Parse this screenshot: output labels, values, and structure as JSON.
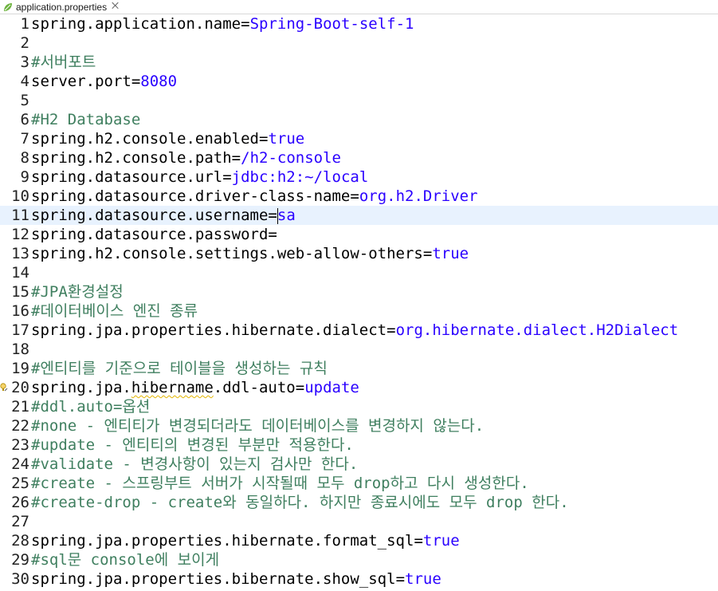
{
  "tab": {
    "title": "application.properties",
    "close_glyph": "⨉"
  },
  "lines": [
    {
      "num": "1",
      "key": "spring.application.name",
      "eq": "=",
      "val": "Spring-Boot-self-1"
    },
    {
      "num": "2"
    },
    {
      "num": "3",
      "comment": "#서버포트"
    },
    {
      "num": "4",
      "key": "server.port",
      "eq": "=",
      "val": "8080"
    },
    {
      "num": "5"
    },
    {
      "num": "6",
      "comment": "#H2 Database"
    },
    {
      "num": "7",
      "key": "spring.h2.console.enabled",
      "eq": "=",
      "val": "true"
    },
    {
      "num": "8",
      "key": "spring.h2.console.path",
      "eq": "=",
      "val": "/h2-console"
    },
    {
      "num": "9",
      "key": "spring.datasource.url",
      "eq": "=",
      "val": "jdbc:h2:~/local"
    },
    {
      "num": "10",
      "key": "spring.datasource.driver-class-name",
      "eq": "=",
      "val": "org.h2.Driver"
    },
    {
      "num": "11",
      "key": "spring.datasource.username",
      "eq": "=",
      "val": "sa"
    },
    {
      "num": "12",
      "key": "spring.datasource.password",
      "eq": "=",
      "val": ""
    },
    {
      "num": "13",
      "key": "spring.h2.console.settings.web-allow-others",
      "eq": "=",
      "val": "true"
    },
    {
      "num": "14"
    },
    {
      "num": "15",
      "comment": "#JPA환경설정"
    },
    {
      "num": "16",
      "comment": "#데이터베이스 엔진 종류"
    },
    {
      "num": "17",
      "key": "spring.jpa.properties.hibernate.dialect",
      "eq": "=",
      "val": "org.hibernate.dialect.H2Dialect"
    },
    {
      "num": "18"
    },
    {
      "num": "19",
      "comment": "#엔티티를 기준으로 테이블을 생성하는 규칙"
    },
    {
      "num": "20",
      "key_pre": "spring.jpa.",
      "key_warn": "hibername",
      "key_post": ".ddl-auto",
      "eq": "=",
      "val": "update"
    },
    {
      "num": "21",
      "comment": "#ddl.auto=옵션"
    },
    {
      "num": "22",
      "comment": "#none - 엔티티가 변경되더라도 데이터베이스를 변경하지 않는다."
    },
    {
      "num": "23",
      "comment": "#update - 엔티티의 변경된 부분만 적용한다."
    },
    {
      "num": "24",
      "comment": "#validate - 변경사항이 있는지 검사만 한다."
    },
    {
      "num": "25",
      "comment": "#create - 스프링부트 서버가 시작될때 모두 drop하고 다시 생성한다."
    },
    {
      "num": "26",
      "comment": "#create-drop - create와 동일하다. 하지만 종료시에도 모두 drop 한다."
    },
    {
      "num": "27"
    },
    {
      "num": "28",
      "key": "spring.jpa.properties.hibernate.format_sql",
      "eq": "=",
      "val": "true"
    },
    {
      "num": "29",
      "comment": "#sql문 console에 보이게"
    },
    {
      "num": "30",
      "key": "spring.jpa.properties.bibernate.show_sql",
      "eq": "=",
      "val": "true"
    }
  ],
  "colors": {
    "key": "#000000",
    "value": "#2a00ff",
    "comment": "#3f7f5f",
    "current_line": "#e8f2fe"
  }
}
